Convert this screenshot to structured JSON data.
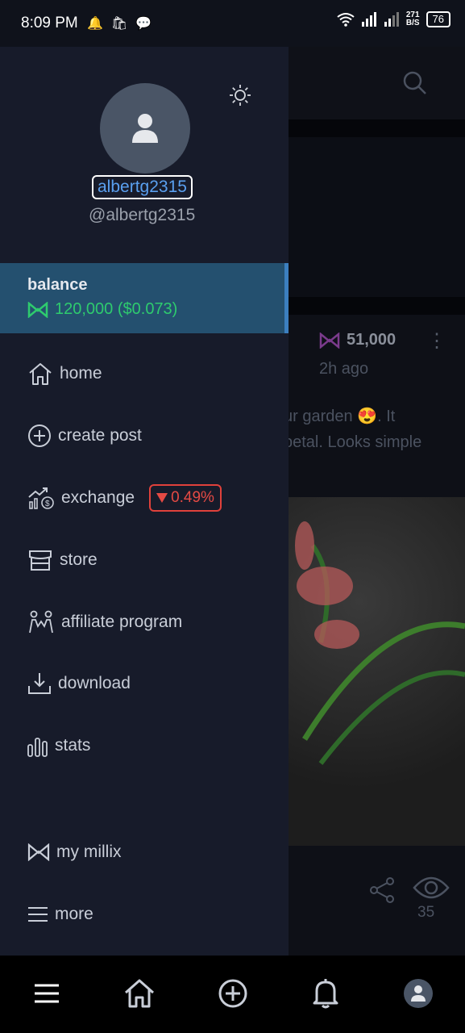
{
  "status": {
    "time": "8:09 PM",
    "net_speed_top": "271",
    "net_speed_bottom": "B/S",
    "battery": "76"
  },
  "drawer": {
    "username": "albertg2315",
    "handle": "@albertg2315",
    "balance": {
      "label": "balance",
      "value": "120,000 ($0.073)"
    },
    "menu": [
      {
        "label": "home",
        "icon": "home-icon"
      },
      {
        "label": "create post",
        "icon": "plus-circle-icon"
      },
      {
        "label": "exchange",
        "icon": "exchange-icon",
        "badge": "0.49%"
      },
      {
        "label": "store",
        "icon": "store-icon"
      },
      {
        "label": "affiliate program",
        "icon": "people-icon"
      },
      {
        "label": "download",
        "icon": "download-icon"
      },
      {
        "label": "stats",
        "icon": "stats-icon"
      },
      {
        "label": "my millix",
        "icon": "millix-icon"
      },
      {
        "label": "more",
        "icon": "hamburger-icon"
      }
    ]
  },
  "feed": {
    "coin_amount": "51,000",
    "time_ago": "2h ago",
    "text_line1": "ur garden 😍. It",
    "text_line2": "petal. Looks simple",
    "views": "35"
  },
  "colors": {
    "drawer_bg": "#171b2a",
    "balance_bg": "#24506f",
    "accent_green": "#2ecb6e",
    "badge_red": "#e54a44",
    "link_blue": "#5aa0f0"
  }
}
